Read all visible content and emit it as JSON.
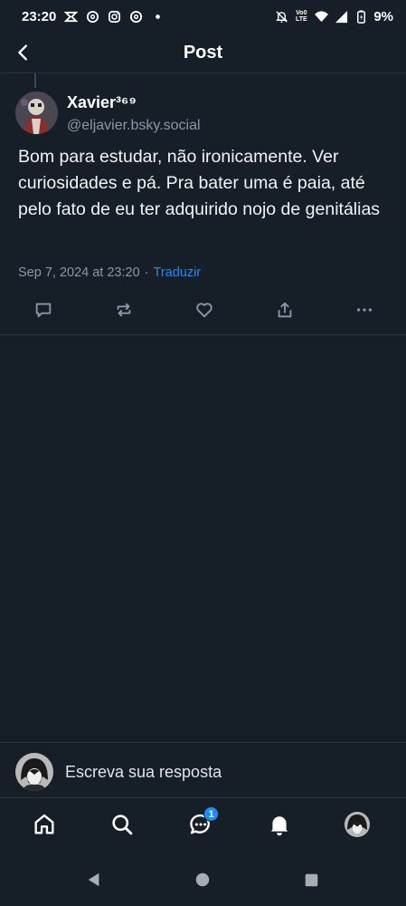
{
  "status_bar": {
    "time": "23:20",
    "battery": "9%",
    "network_top": "Vo0",
    "network_bottom": "LTE",
    "icons_left": [
      "capcut-icon",
      "threads-icon",
      "instagram-icon",
      "threads-icon",
      "dot-icon"
    ],
    "icons_right": [
      "silent-icon",
      "volte-icon",
      "wifi-icon",
      "signal-icon",
      "battery-icon"
    ]
  },
  "header": {
    "title": "Post"
  },
  "post": {
    "author_name": "Xavier³⁶⁹",
    "author_handle": "@eljavier.bsky.social",
    "text": "Bom para estudar, não ironicamente. Ver curiosidades e pá. Pra bater uma é paia, até pelo fato de eu ter adquirido nojo de genitálias",
    "timestamp": "Sep 7, 2024 at 23:20",
    "separator": "·",
    "translate_label": "Traduzir"
  },
  "reply": {
    "placeholder": "Escreva sua resposta"
  },
  "bottom_nav": {
    "items": [
      "home",
      "search",
      "chat",
      "notifications",
      "profile"
    ],
    "chat_badge": "1"
  },
  "colors": {
    "background": "#161e27",
    "divider": "#2a3441",
    "accent": "#208bfe",
    "muted": "#8b98a9"
  }
}
